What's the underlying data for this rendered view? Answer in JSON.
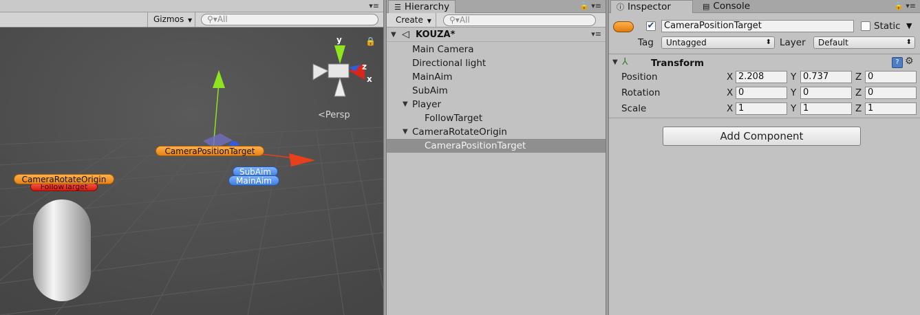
{
  "scene": {
    "gizmos_label": "Gizmos",
    "search_placeholder": "All",
    "persp_label": "Persp",
    "axis_y": "y",
    "axis_z": "z",
    "axis_x": "x",
    "labels": {
      "camera_position_target": "CameraPositionTarget",
      "camera_rotate_origin": "CameraRotateOrigin",
      "follow_target": "FollowTarget",
      "sub_aim": "SubAim",
      "main_aim": "MainAim"
    }
  },
  "hierarchy": {
    "tab_label": "Hierarchy",
    "create_label": "Create",
    "search_placeholder": "All",
    "scene_name": "KOUZA*",
    "items": [
      {
        "label": "Main Camera"
      },
      {
        "label": "Directional light"
      },
      {
        "label": "MainAim"
      },
      {
        "label": "SubAim"
      },
      {
        "label": "Player"
      },
      {
        "label": "FollowTarget"
      },
      {
        "label": "CameraRotateOrigin"
      },
      {
        "label": "CameraPositionTarget"
      }
    ]
  },
  "inspector": {
    "tab_label": "Inspector",
    "console_tab_label": "Console",
    "object_name": "CameraPositionTarget",
    "static_label": "Static",
    "tag_label": "Tag",
    "tag_value": "Untagged",
    "layer_label": "Layer",
    "layer_value": "Default",
    "component_title": "Transform",
    "rows": [
      {
        "label": "Position",
        "x": "2.208",
        "y": "0.737",
        "z": "0"
      },
      {
        "label": "Rotation",
        "x": "0",
        "y": "0",
        "z": "0"
      },
      {
        "label": "Scale",
        "x": "1",
        "y": "1",
        "z": "1"
      }
    ],
    "axis_labels": {
      "x": "X",
      "y": "Y",
      "z": "Z"
    },
    "add_component_label": "Add Component"
  },
  "colors": {
    "selection": "#8f8f8f",
    "label_orange": "#f39a2a",
    "label_blue": "#4c8ae8",
    "label_red": "#e0291a",
    "axis_green": "#8fe31f",
    "axis_red": "#e8401a"
  }
}
